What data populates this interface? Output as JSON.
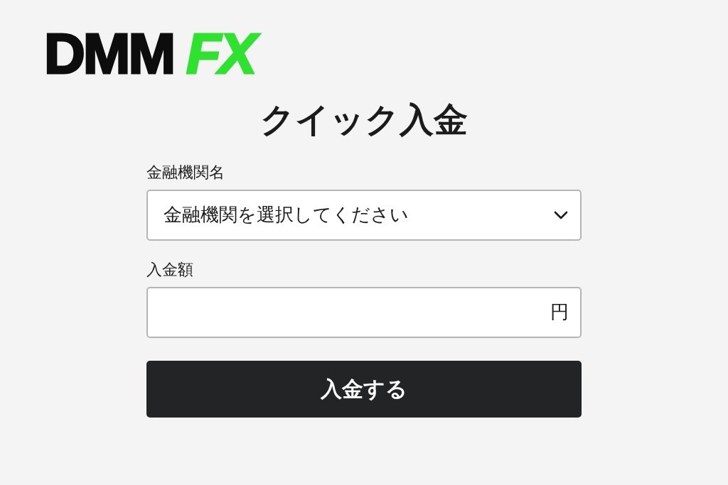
{
  "logo": {
    "parts": [
      {
        "text": "DMM",
        "color": "#0d0d0d"
      },
      {
        "text": "FX",
        "color": "#2fe22f"
      }
    ]
  },
  "title": "クイック入金",
  "fields": [
    {
      "kind": "select",
      "label": "金融機関名",
      "value": "金融機関を選択してください"
    },
    {
      "kind": "amount",
      "label": "入金額",
      "suffix": "円"
    }
  ],
  "submit": "入金する"
}
